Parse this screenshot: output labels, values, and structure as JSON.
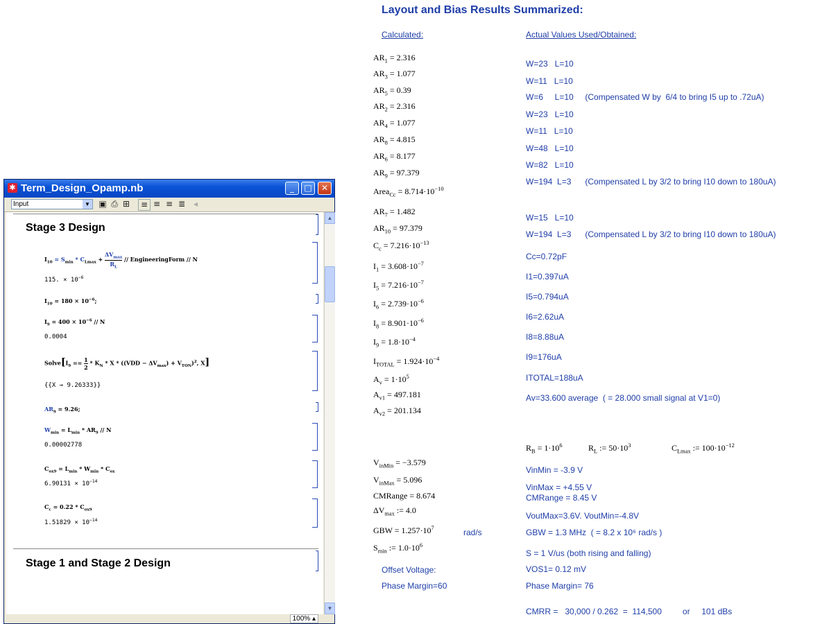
{
  "summary": {
    "title": "Layout and Bias Results Summarized:",
    "col_calculated": "Calculated:      ",
    "col_actual": "Actual Values Used/Obtained:",
    "calculated": [
      {
        "base": "AR",
        "sub": "1",
        "rest": " = 2.316"
      },
      {
        "base": "AR",
        "sub": "3",
        "rest": " = 1.077"
      },
      {
        "base": "AR",
        "sub": "5",
        "rest": " = 0.39"
      },
      {
        "base": "AR",
        "sub": "2",
        "rest": " = 2.316"
      },
      {
        "base": "AR",
        "sub": "4",
        "rest": " = 1.077"
      },
      {
        "base": "AR",
        "sub": "8",
        "rest": " = 4.815"
      },
      {
        "base": "AR",
        "sub": "6",
        "rest": " = 8.177"
      },
      {
        "base": "AR",
        "sub": "9",
        "rest": " = 97.379"
      },
      {
        "base": "Area",
        "sub": "Cc",
        "rest": " = 8.714·10",
        "sup": "−10"
      },
      {
        "base": "AR",
        "sub": "7",
        "rest": " = 1.482"
      },
      {
        "base": "AR",
        "sub": "10",
        "rest": " = 97.379"
      },
      {
        "base": "C",
        "sub": "c",
        "rest": " = 7.216·10",
        "sup": "−13"
      },
      {
        "base": "I",
        "sub": "1",
        "rest": " = 3.608·10",
        "sup": "−7"
      },
      {
        "base": "I",
        "sub": "5",
        "rest": " = 7.216·10",
        "sup": "−7"
      },
      {
        "base": "I",
        "sub": "6",
        "rest": " = 2.739·10",
        "sup": "−6"
      },
      {
        "base": "I",
        "sub": "8",
        "rest": " = 8.901·10",
        "sup": "−6"
      },
      {
        "base": "I",
        "sub": "9",
        "rest": " = 1.8·10",
        "sup": "−4"
      },
      {
        "base": "I",
        "sub": "TOTAL",
        "rest": " = 1.924·10",
        "sup": "−4"
      },
      {
        "base": "A",
        "sub": "v",
        "rest": " = 1·10",
        "sup": "5"
      },
      {
        "base": "A",
        "sub": "v1",
        "rest": " = 497.181"
      },
      {
        "base": "A",
        "sub": "v2",
        "rest": " = 201.134"
      },
      {
        "base": "V",
        "sub": "inMin",
        "rest": " = −3.579"
      },
      {
        "base": "V",
        "sub": "inMax",
        "rest": " = 5.096"
      },
      {
        "base": "CMRange",
        "rest": " = 8.674"
      },
      {
        "base": "ΔV",
        "sub": "max",
        "rest": " := 4.0"
      },
      {
        "base": "GBW",
        "rest": " = 1.257·10",
        "sup": "7"
      },
      {
        "base": "S",
        "sub": "min",
        "rest": " := 1.0·10",
        "sup": "6"
      }
    ],
    "gbw_unit": "rad/s",
    "offset_label": "Offset Voltage:",
    "phase_label": "Phase Margin=60",
    "actual": [
      "W=23   L=10",
      "W=11   L=10",
      "W=6     L=10     (Compensated W by  6/4 to bring I5 up to .72uA)",
      "W=23   L=10",
      "W=11   L=10",
      "W=48   L=10",
      "W=82   L=10",
      "W=194  L=3      (Compensated L by 3/2 to bring I10 down to 180uA)",
      "W=15   L=10",
      "W=194  L=3      (Compensated L by 3/2 to bring I10 down to 180uA)",
      "Cc=0.72pF",
      "I1=0.397uA",
      "I5=0.794uA",
      "I6=2.62uA",
      "I8=8.88uA",
      "I9=176uA",
      "ITOTAL=188uA",
      "Av=33.600 average  ( = 28.000 small signal at V1=0)"
    ],
    "params": {
      "rb": "R",
      "rb_sub": "B",
      "rb_val": " = 1·10",
      "rb_sup": "6",
      "rl": "R",
      "rl_sub": "L",
      "rl_val": " := 50·10",
      "rl_sup": "3",
      "cl": "C",
      "cl_sub": "Lmax",
      "cl_val": " := 100·10",
      "cl_sup": "−12"
    },
    "actual2": [
      "VinMin = -3.9 V",
      "VinMax = +4.55 V",
      "CMRange = 8.45 V",
      "VoutMax=3.6V. VoutMin=-4.8V",
      "GBW = 1.3 MHz  ( = 8.2 x 10⁶ rad/s )",
      "S = 1 V/us (both rising and falling)",
      "VOS1= 0.12 mV",
      "Phase Margin= 76",
      "CMRR =   30,000 / 0.262  =  114,500         or     101 dBs"
    ]
  },
  "window": {
    "title": "Term_Design_Opamp.nb",
    "style_value": "Input",
    "zoom": "100%",
    "section1": "Stage 3 Design",
    "section2": "Stage 1 and Stage 2 Design",
    "cells": {
      "in1_a": "I",
      "in1_a_sub": "10",
      "in1_b": " = S",
      "in1_b_sub": "min",
      "in1_c": " * C",
      "in1_c_sub": "Lmax",
      "in1_d": " + ",
      "in1_num": "ΔV",
      "in1_num_sub": "max",
      "in1_den": "R",
      "in1_den_sub": "L",
      "in1_e": " // EngineeringForm // N",
      "out1": "115. × 10",
      "out1_sup": "−6",
      "in2": "I",
      "in2_sub": "10",
      "in2_rest": " = 180 × 10",
      "in2_sup": "−6",
      "in2_end": ";",
      "in3": "I",
      "in3_sub": "9",
      "in3_rest": " = 400 × 10",
      "in3_sup": "−6",
      "in3_end": " // N",
      "out3": "0.0004",
      "in4_a": "Solve",
      "in4_b": "I",
      "in4_b_sub": "9",
      "in4_c": " == ",
      "in4_frac_num": "1",
      "in4_frac_den": "2",
      "in4_d": " * K",
      "in4_d_sub": "N",
      "in4_e": " * X * ((VDD − ΔV",
      "in4_e_sub": "max",
      "in4_f": ") + V",
      "in4_f_sub": "TON",
      "in4_g": ")",
      "in4_g_sup": "2",
      "in4_h": ", X",
      "out4": "{{X → 9.26333}}",
      "in5_a": "AR",
      "in5_sub": "9",
      "in5_b": " = 9.26;",
      "in6_a": "W",
      "in6_a_sub": "min",
      "in6_b": " = L",
      "in6_b_sub": "min",
      "in6_c": " * AR",
      "in6_c_sub": "9",
      "in6_d": " // N",
      "out6": "0.00002778",
      "in7_a": "C",
      "in7_a_sub": "ox9",
      "in7_b": " = L",
      "in7_b_sub": "min",
      "in7_c": " * W",
      "in7_c_sub": "min",
      "in7_d": " * C",
      "in7_d_sub": "ox",
      "out7": "6.90131 × 10",
      "out7_sup": "−14",
      "in8_a": "C",
      "in8_a_sub": "c",
      "in8_b": " = 0.22 * C",
      "in8_b_sub": "ox9",
      "out8": "1.51829 × 10",
      "out8_sup": "−14"
    }
  }
}
